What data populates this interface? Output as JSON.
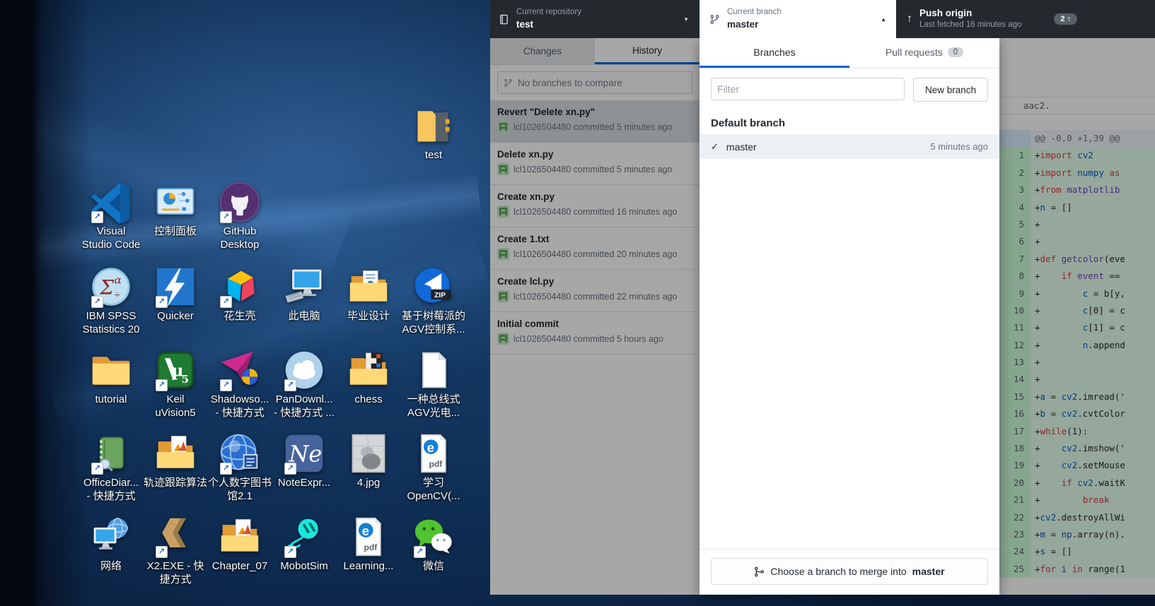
{
  "colors": {
    "accent_blue": "#0366d6",
    "header_dark": "#24292e",
    "add_line_bg": "#e6ffed",
    "add_gutter_bg": "#cdffd8",
    "selection_bg": "#edf1f5"
  },
  "desktop": {
    "icons": [
      {
        "type": "folder-open",
        "label": "test",
        "col": 6,
        "row": 0,
        "shortcut": false
      },
      {
        "type": "vscode",
        "label": "Visual\nStudio Code",
        "col": 1,
        "row": 1,
        "shortcut": true
      },
      {
        "type": "cpanel",
        "label": "控制面板",
        "col": 2,
        "row": 1,
        "shortcut": false
      },
      {
        "type": "github",
        "label": "GitHub\nDesktop",
        "col": 3,
        "row": 1,
        "shortcut": true
      },
      {
        "type": "spss",
        "label": "IBM SPSS\nStatistics 20",
        "col": 1,
        "row": 2,
        "shortcut": true
      },
      {
        "type": "quicker",
        "label": "Quicker",
        "col": 2,
        "row": 2,
        "shortcut": true
      },
      {
        "type": "cube",
        "label": "花生壳",
        "col": 3,
        "row": 2,
        "shortcut": true
      },
      {
        "type": "pc",
        "label": "此电脑",
        "col": 4,
        "row": 2,
        "shortcut": false
      },
      {
        "type": "folder-docs",
        "label": "毕业设计",
        "col": 5,
        "row": 2,
        "shortcut": false
      },
      {
        "type": "zipball",
        "label": "基于树莓派的\nAGV控制系...",
        "col": 6,
        "row": 2,
        "shortcut": false
      },
      {
        "type": "folder",
        "label": "tutorial",
        "col": 1,
        "row": 3,
        "shortcut": false
      },
      {
        "type": "keil",
        "label": "Keil\nuVision5",
        "col": 2,
        "row": 3,
        "shortcut": true
      },
      {
        "type": "shadow",
        "label": "Shadowso...\n- 快捷方式",
        "col": 3,
        "row": 3,
        "shortcut": true
      },
      {
        "type": "cloud",
        "label": "PanDownl...\n- 快捷方式 ...",
        "col": 4,
        "row": 3,
        "shortcut": true
      },
      {
        "type": "folder-chess",
        "label": "chess",
        "col": 5,
        "row": 3,
        "shortcut": false
      },
      {
        "type": "doc",
        "label": "一种总线式\nAGV光电...",
        "col": 6,
        "row": 3,
        "shortcut": false
      },
      {
        "type": "notebook",
        "label": "OfficeDiar...\n- 快捷方式",
        "col": 1,
        "row": 4,
        "shortcut": true
      },
      {
        "type": "folder-matlab",
        "label": "轨迹跟踪算法",
        "col": 2,
        "row": 4,
        "shortcut": false
      },
      {
        "type": "globe",
        "label": "个人数字图书\n馆2.1",
        "col": 3,
        "row": 4,
        "shortcut": true
      },
      {
        "type": "ne",
        "label": "NoteExpr...",
        "col": 4,
        "row": 4,
        "shortcut": true
      },
      {
        "type": "image",
        "label": "4.jpg",
        "col": 5,
        "row": 4,
        "shortcut": false
      },
      {
        "type": "pdf",
        "label": "学习\nOpenCV(...",
        "col": 6,
        "row": 4,
        "shortcut": false
      },
      {
        "type": "network",
        "label": "网络",
        "col": 1,
        "row": 5,
        "shortcut": false
      },
      {
        "type": "x2",
        "label": "X2.EXE - 快\n捷方式",
        "col": 2,
        "row": 5,
        "shortcut": true
      },
      {
        "type": "folder-matlab",
        "label": "Chapter_07",
        "col": 3,
        "row": 5,
        "shortcut": false
      },
      {
        "type": "mobot",
        "label": "MobotSim",
        "col": 4,
        "row": 5,
        "shortcut": true
      },
      {
        "type": "pdf",
        "label": "Learning...",
        "col": 5,
        "row": 5,
        "shortcut": false
      },
      {
        "type": "wechat",
        "label": "微信",
        "col": 6,
        "row": 5,
        "shortcut": true
      }
    ]
  },
  "header": {
    "repo_label": "Current repository",
    "repo_value": "test",
    "branch_label": "Current branch",
    "branch_value": "master",
    "push_title": "Push origin",
    "push_subtitle": "Last fetched 16 minutes ago",
    "push_count": "2 ↑"
  },
  "tabs": {
    "changes": "Changes",
    "history": "History"
  },
  "compare_placeholder": "No branches to compare",
  "history": [
    {
      "title": "Revert \"Delete xn.py\"",
      "meta": "lcl1026504480 committed 5 minutes ago",
      "selected": true
    },
    {
      "title": "Delete xn.py",
      "meta": "lcl1026504480 committed 5 minutes ago",
      "selected": false
    },
    {
      "title": "Create xn.py",
      "meta": "lcl1026504480 committed 16 minutes ago",
      "selected": false
    },
    {
      "title": "Create 1.txt",
      "meta": "lcl1026504480 committed 20 minutes ago",
      "selected": false
    },
    {
      "title": "Create lcl.py",
      "meta": "lcl1026504480 committed 22 minutes ago",
      "selected": false
    },
    {
      "title": "Initial commit",
      "meta": "lcl1026504480 committed 5 hours ago",
      "selected": false
    }
  ],
  "branches": {
    "tab_branches": "Branches",
    "tab_pulls": "Pull requests",
    "pulls_badge": "0",
    "filter_placeholder": "Filter",
    "new_branch": "New branch",
    "section": "Default branch",
    "check": "✓",
    "rows": [
      {
        "name": "master",
        "time": "5 minutes ago"
      }
    ],
    "merge_prefix": "Choose a branch to merge into ",
    "merge_target": "master"
  },
  "diff": {
    "meta": "aac2.",
    "hunk": "@@ -0,0 +1,39 @@",
    "lines": [
      {
        "n": "1",
        "tokens": [
          [
            "p",
            "+"
          ],
          [
            "k",
            "import"
          ],
          [
            "p",
            " "
          ],
          [
            "b",
            "cv2"
          ]
        ]
      },
      {
        "n": "2",
        "tokens": [
          [
            "p",
            "+"
          ],
          [
            "k",
            "import"
          ],
          [
            "p",
            " "
          ],
          [
            "b",
            "numpy"
          ],
          [
            "p",
            " "
          ],
          [
            "k",
            "as"
          ]
        ]
      },
      {
        "n": "3",
        "tokens": [
          [
            "p",
            "+"
          ],
          [
            "k",
            "from"
          ],
          [
            "p",
            " "
          ],
          [
            "v",
            "matplotlib"
          ]
        ]
      },
      {
        "n": "4",
        "tokens": [
          [
            "p",
            "+"
          ],
          [
            "b",
            "n"
          ],
          [
            "p",
            " = []"
          ]
        ]
      },
      {
        "n": "5",
        "tokens": [
          [
            "p",
            "+"
          ]
        ]
      },
      {
        "n": "6",
        "tokens": [
          [
            "p",
            "+"
          ]
        ]
      },
      {
        "n": "7",
        "tokens": [
          [
            "p",
            "+"
          ],
          [
            "k",
            "def"
          ],
          [
            "p",
            " "
          ],
          [
            "v",
            "getcolor"
          ],
          [
            "p",
            "(eve"
          ]
        ]
      },
      {
        "n": "8",
        "tokens": [
          [
            "p",
            "+    "
          ],
          [
            "k",
            "if"
          ],
          [
            "p",
            " "
          ],
          [
            "v",
            "event"
          ],
          [
            "p",
            " =="
          ]
        ]
      },
      {
        "n": "9",
        "tokens": [
          [
            "p",
            "+        "
          ],
          [
            "b",
            "c"
          ],
          [
            "p",
            " = b[y,"
          ]
        ]
      },
      {
        "n": "10",
        "tokens": [
          [
            "p",
            "+        "
          ],
          [
            "b",
            "c"
          ],
          [
            "p",
            "[0] = c"
          ]
        ]
      },
      {
        "n": "11",
        "tokens": [
          [
            "p",
            "+        "
          ],
          [
            "b",
            "c"
          ],
          [
            "p",
            "[1] = c"
          ]
        ]
      },
      {
        "n": "12",
        "tokens": [
          [
            "p",
            "+        "
          ],
          [
            "b",
            "n"
          ],
          [
            "p",
            ".append"
          ]
        ]
      },
      {
        "n": "13",
        "tokens": [
          [
            "p",
            "+"
          ]
        ]
      },
      {
        "n": "14",
        "tokens": [
          [
            "p",
            "+"
          ]
        ]
      },
      {
        "n": "15",
        "tokens": [
          [
            "p",
            "+"
          ],
          [
            "b",
            "a"
          ],
          [
            "p",
            " = "
          ],
          [
            "b",
            "cv2"
          ],
          [
            "p",
            ".imread('"
          ]
        ]
      },
      {
        "n": "16",
        "tokens": [
          [
            "p",
            "+"
          ],
          [
            "b",
            "b"
          ],
          [
            "p",
            " = "
          ],
          [
            "b",
            "cv2"
          ],
          [
            "p",
            ".cvtColor"
          ]
        ]
      },
      {
        "n": "17",
        "tokens": [
          [
            "p",
            "+"
          ],
          [
            "k",
            "while"
          ],
          [
            "p",
            "(1):"
          ]
        ]
      },
      {
        "n": "18",
        "tokens": [
          [
            "p",
            "+    "
          ],
          [
            "b",
            "cv2"
          ],
          [
            "p",
            ".imshow('"
          ]
        ]
      },
      {
        "n": "19",
        "tokens": [
          [
            "p",
            "+    "
          ],
          [
            "b",
            "cv2"
          ],
          [
            "p",
            ".setMouse"
          ]
        ]
      },
      {
        "n": "20",
        "tokens": [
          [
            "p",
            "+    "
          ],
          [
            "k",
            "if"
          ],
          [
            "p",
            " "
          ],
          [
            "b",
            "cv2"
          ],
          [
            "p",
            ".waitK"
          ]
        ]
      },
      {
        "n": "21",
        "tokens": [
          [
            "p",
            "+        "
          ],
          [
            "k",
            "break"
          ]
        ]
      },
      {
        "n": "22",
        "tokens": [
          [
            "p",
            "+"
          ],
          [
            "b",
            "cv2"
          ],
          [
            "p",
            ".destroyAllWi"
          ]
        ]
      },
      {
        "n": "23",
        "tokens": [
          [
            "p",
            "+"
          ],
          [
            "b",
            "m"
          ],
          [
            "p",
            " = "
          ],
          [
            "b",
            "np"
          ],
          [
            "p",
            ".array(n)."
          ]
        ]
      },
      {
        "n": "24",
        "tokens": [
          [
            "p",
            "+"
          ],
          [
            "b",
            "s"
          ],
          [
            "p",
            " = []"
          ]
        ]
      },
      {
        "n": "25",
        "tokens": [
          [
            "p",
            "+"
          ],
          [
            "k",
            "for"
          ],
          [
            "p",
            " "
          ],
          [
            "b",
            "i"
          ],
          [
            "p",
            " "
          ],
          [
            "k",
            "in"
          ],
          [
            "p",
            " range(1"
          ]
        ]
      }
    ]
  }
}
